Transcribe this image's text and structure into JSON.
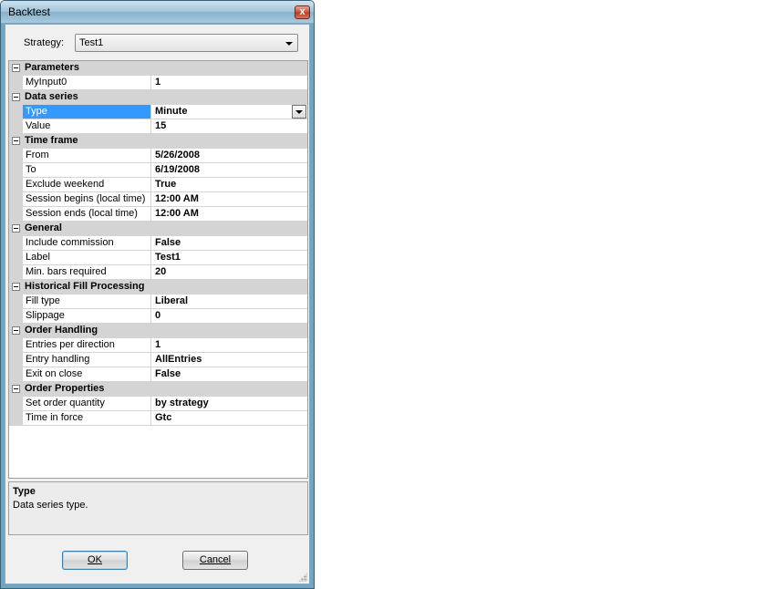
{
  "window": {
    "title": "Backtest",
    "close_glyph": "x"
  },
  "strategy": {
    "label": "Strategy:",
    "value": "Test1"
  },
  "grid": {
    "categories": [
      {
        "name": "Parameters",
        "props": [
          {
            "name": "MyInput0",
            "value": "1"
          }
        ]
      },
      {
        "name": "Data series",
        "props": [
          {
            "name": "Type",
            "value": "Minute",
            "selected": true,
            "dropdown": true
          },
          {
            "name": "Value",
            "value": "15"
          }
        ]
      },
      {
        "name": "Time frame",
        "props": [
          {
            "name": "From",
            "value": "5/26/2008"
          },
          {
            "name": "To",
            "value": "6/19/2008"
          },
          {
            "name": "Exclude weekend",
            "value": "True"
          },
          {
            "name": "Session begins (local time)",
            "value": "12:00 AM"
          },
          {
            "name": "Session ends (local time)",
            "value": "12:00 AM"
          }
        ]
      },
      {
        "name": "General",
        "props": [
          {
            "name": "Include commission",
            "value": "False"
          },
          {
            "name": "Label",
            "value": "Test1"
          },
          {
            "name": "Min. bars required",
            "value": "20"
          }
        ]
      },
      {
        "name": "Historical Fill Processing",
        "props": [
          {
            "name": "Fill type",
            "value": "Liberal"
          },
          {
            "name": "Slippage",
            "value": "0"
          }
        ]
      },
      {
        "name": "Order Handling",
        "props": [
          {
            "name": "Entries per direction",
            "value": "1"
          },
          {
            "name": "Entry handling",
            "value": "AllEntries"
          },
          {
            "name": "Exit on close",
            "value": "False"
          }
        ]
      },
      {
        "name": "Order Properties",
        "props": [
          {
            "name": "Set order quantity",
            "value": "by strategy"
          },
          {
            "name": "Time in force",
            "value": "Gtc"
          }
        ]
      }
    ]
  },
  "help": {
    "title": "Type",
    "description": "Data series type."
  },
  "buttons": {
    "ok_label": "OK",
    "cancel_label": "Cancel"
  }
}
